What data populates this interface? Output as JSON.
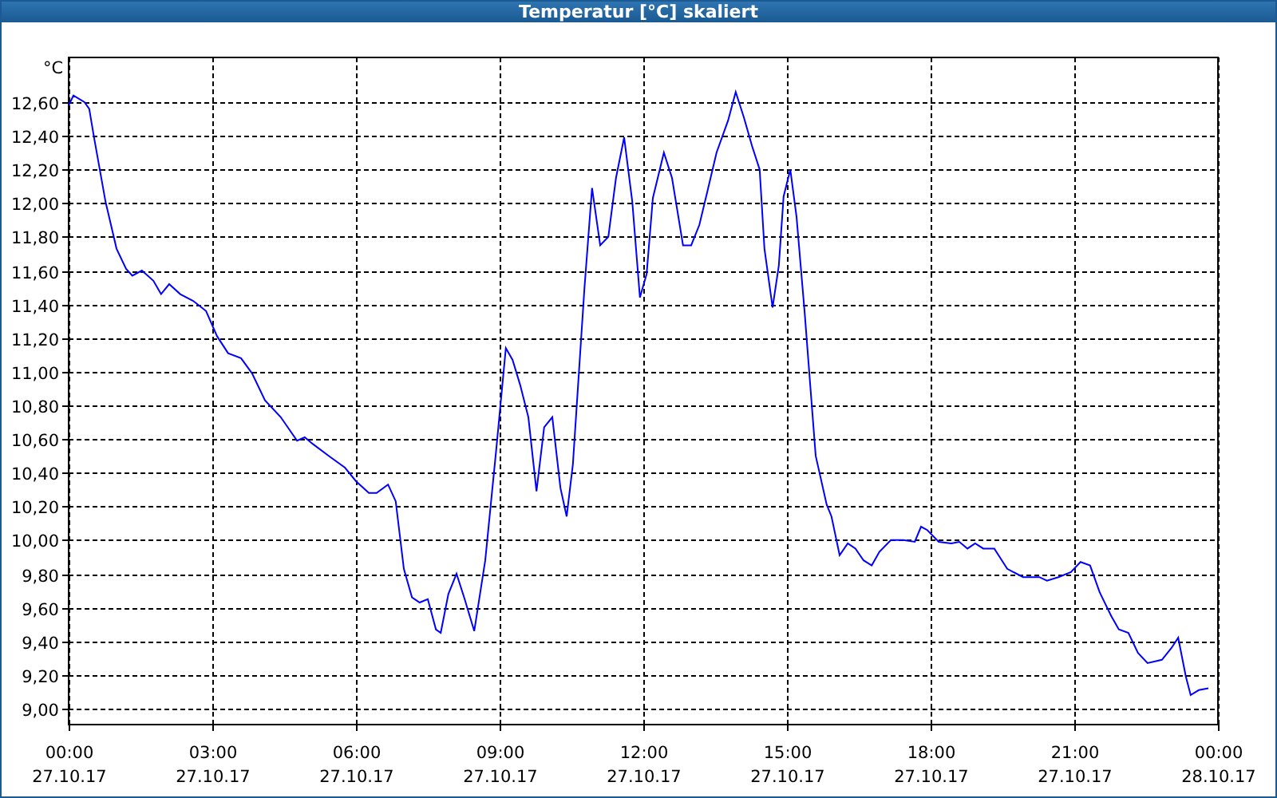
{
  "window": {
    "title": "Temperatur [°C] skaliert"
  },
  "chart": {
    "unit": "°C",
    "date_labels": [
      "27.10.17",
      "27.10.17",
      "27.10.17",
      "27.10.17",
      "27.10.17",
      "27.10.17",
      "27.10.17",
      "27.10.17",
      "28.10.17"
    ],
    "chart_data": {
      "type": "line",
      "grid": true,
      "xlim": [
        0,
        24
      ],
      "ylim": [
        8.905,
        12.865
      ],
      "xticks": [
        {
          "value": 0,
          "label": "00:00"
        },
        {
          "value": 3,
          "label": "03:00"
        },
        {
          "value": 6,
          "label": "06:00"
        },
        {
          "value": 9,
          "label": "09:00"
        },
        {
          "value": 12,
          "label": "12:00"
        },
        {
          "value": 15,
          "label": "15:00"
        },
        {
          "value": 18,
          "label": "18:00"
        },
        {
          "value": 21,
          "label": "21:00"
        },
        {
          "value": 24,
          "label": "00:00"
        }
      ],
      "yticks": [
        {
          "value": 9.0,
          "label": "9,00"
        },
        {
          "value": 9.2,
          "label": "9,20"
        },
        {
          "value": 9.4,
          "label": "9,40"
        },
        {
          "value": 9.6,
          "label": "9,60"
        },
        {
          "value": 9.8,
          "label": "9,80"
        },
        {
          "value": 10.0,
          "label": "10,00"
        },
        {
          "value": 10.2,
          "label": "10,20"
        },
        {
          "value": 10.4,
          "label": "10,40"
        },
        {
          "value": 10.6,
          "label": "10,60"
        },
        {
          "value": 10.8,
          "label": "10,80"
        },
        {
          "value": 11.0,
          "label": "11,00"
        },
        {
          "value": 11.2,
          "label": "11,20"
        },
        {
          "value": 11.4,
          "label": "11,40"
        },
        {
          "value": 11.6,
          "label": "11,60"
        },
        {
          "value": 11.8,
          "label": "11,80"
        },
        {
          "value": 12.0,
          "label": "12,00"
        },
        {
          "value": 12.2,
          "label": "12,20"
        },
        {
          "value": 12.4,
          "label": "12,40"
        },
        {
          "value": 12.6,
          "label": "12,60"
        }
      ],
      "x": [
        0,
        0.1,
        0.33,
        0.43,
        0.53,
        0.77,
        1,
        1.2,
        1.33,
        1.53,
        1.77,
        1.93,
        2.1,
        2.33,
        2.6,
        2.87,
        3.1,
        3.33,
        3.6,
        3.83,
        4.1,
        4.43,
        4.77,
        4.93,
        5.1,
        5.43,
        5.77,
        6,
        6.27,
        6.43,
        6.67,
        6.83,
        7,
        7.17,
        7.33,
        7.5,
        7.67,
        7.77,
        7.93,
        8.1,
        8.27,
        8.47,
        8.7,
        8.93,
        9.13,
        9.27,
        9.43,
        9.6,
        9.77,
        9.93,
        10.1,
        10.27,
        10.4,
        10.53,
        10.77,
        10.93,
        11.1,
        11.27,
        11.43,
        11.6,
        11.77,
        11.93,
        12.07,
        12.2,
        12.43,
        12.6,
        12.83,
        13,
        13.17,
        13.33,
        13.53,
        13.77,
        13.93,
        14.1,
        14.27,
        14.43,
        14.53,
        14.7,
        14.83,
        14.93,
        15.07,
        15.2,
        15.37,
        15.6,
        15.83,
        15.93,
        16.1,
        16.27,
        16.43,
        16.6,
        16.77,
        16.93,
        17.17,
        17.43,
        17.67,
        17.8,
        17.93,
        18.17,
        18.43,
        18.6,
        18.77,
        18.93,
        19.1,
        19.33,
        19.6,
        19.93,
        20.27,
        20.43,
        20.67,
        20.93,
        21.13,
        21.33,
        21.53,
        21.77,
        21.93,
        22.13,
        22.33,
        22.53,
        22.83,
        23.03,
        23.17,
        23.33,
        23.43,
        23.6,
        23.8
      ],
      "series": [
        {
          "color": "#0000ff",
          "values": [
            12.58,
            12.64,
            12.6,
            12.56,
            12.39,
            12.01,
            11.73,
            11.61,
            11.57,
            11.6,
            11.54,
            11.46,
            11.52,
            11.46,
            11.42,
            11.36,
            11.21,
            11.11,
            11.08,
            10.99,
            10.83,
            10.73,
            10.59,
            10.61,
            10.57,
            10.5,
            10.43,
            10.35,
            10.28,
            10.28,
            10.33,
            10.23,
            9.83,
            9.66,
            9.63,
            9.65,
            9.47,
            9.45,
            9.68,
            9.8,
            9.65,
            9.46,
            9.88,
            10.54,
            11.14,
            11.07,
            10.92,
            10.73,
            10.29,
            10.67,
            10.73,
            10.31,
            10.14,
            10.45,
            11.49,
            12.09,
            11.75,
            11.8,
            12.15,
            12.39,
            12.01,
            11.44,
            11.58,
            12.03,
            12.3,
            12.15,
            11.75,
            11.75,
            11.87,
            12.06,
            12.3,
            12.49,
            12.66,
            12.51,
            12.34,
            12.2,
            11.73,
            11.38,
            11.63,
            12.04,
            12.2,
            11.92,
            11.35,
            10.5,
            10.21,
            10.14,
            9.91,
            9.98,
            9.95,
            9.88,
            9.85,
            9.93,
            10.0,
            10.0,
            9.99,
            10.08,
            10.06,
            9.99,
            9.98,
            9.99,
            9.95,
            9.98,
            9.95,
            9.95,
            9.83,
            9.78,
            9.78,
            9.76,
            9.78,
            9.81,
            9.87,
            9.85,
            9.69,
            9.55,
            9.47,
            9.45,
            9.33,
            9.27,
            9.29,
            9.36,
            9.42,
            9.19,
            9.08,
            9.11,
            9.12
          ]
        }
      ]
    }
  }
}
